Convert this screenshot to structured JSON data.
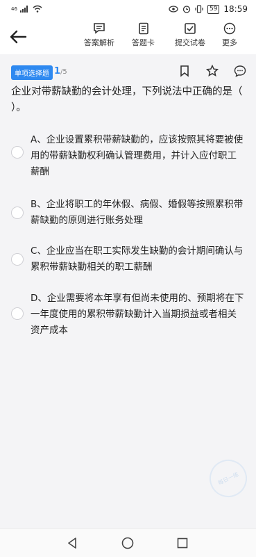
{
  "status_bar": {
    "signal_label": "46",
    "battery": "59",
    "time": "18:59"
  },
  "header": {
    "toolbar": [
      {
        "label": "答案解析",
        "icon": "chat-icon"
      },
      {
        "label": "答题卡",
        "icon": "answer-card-icon"
      },
      {
        "label": "提交试卷",
        "icon": "submit-icon"
      },
      {
        "label": "更多",
        "icon": "more-icon"
      }
    ]
  },
  "question": {
    "type": "单项选择题",
    "current": "1",
    "total": "/5",
    "text": "企业对带薪缺勤的会计处理，下列说法中正确的是（ ）。",
    "options": [
      {
        "label": "A、企业设置累积带薪缺勤的，应该按照其将要被使用的带薪缺勤权利确认管理费用，并计入应付职工薪酬"
      },
      {
        "label": "B、企业将职工的年休假、病假、婚假等按照累积带薪缺勤的原则进行账务处理"
      },
      {
        "label": "C、企业应当在职工实际发生缺勤的会计期间确认与累积带薪缺勤相关的职工薪酬"
      },
      {
        "label": "D、企业需要将本年享有但尚未使用的、预期将在下一年度使用的累积带薪缺勤计入当期损益或者相关资产成本"
      }
    ]
  },
  "watermark": {
    "text": "每日一练"
  }
}
